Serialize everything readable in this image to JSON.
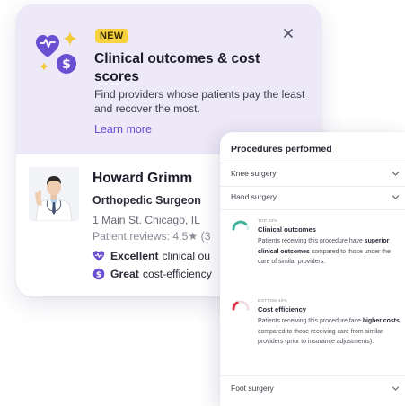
{
  "promo": {
    "badge": "NEW",
    "title": "Clinical outcomes & cost scores",
    "description": "Find providers whose patients pay the least and recover the most.",
    "link": "Learn more"
  },
  "provider": {
    "name": "Howard Grimm",
    "specialty": "Orthopedic Surgeon",
    "address": "1 Main St. Chicago, IL",
    "reviews": "Patient reviews: 4.5★ (3",
    "ratings": [
      {
        "level": "Excellent",
        "label": "clinical ou"
      },
      {
        "level": "Great",
        "label": "cost-efficiency"
      }
    ]
  },
  "procedures": {
    "title": "Procedures performed",
    "items": [
      "Knee surgery",
      "Hand surgery",
      "Foot surgery"
    ],
    "metrics": [
      {
        "tag": "TOP 20%",
        "heading": "Clinical outcomes",
        "body_pre": "Patients receiving this procedure have ",
        "body_bold": "superior clinical outcomes",
        "body_post": " compared to those under the care of similar providers."
      },
      {
        "tag": "BOTTOM 40%",
        "heading": "Cost efficiency",
        "body_pre": "Patients receiving this procedure face ",
        "body_bold": "higher costs",
        "body_post": " compared to those receiving care from similar providers (prior to insurance adjustments)."
      }
    ]
  },
  "colors": {
    "accent_purple": "#6a4fd3",
    "badge_yellow": "#f5d23e",
    "good_teal": "#3fb39a",
    "bad_red": "#d9344a",
    "promo_bg": "#ede9f8"
  }
}
